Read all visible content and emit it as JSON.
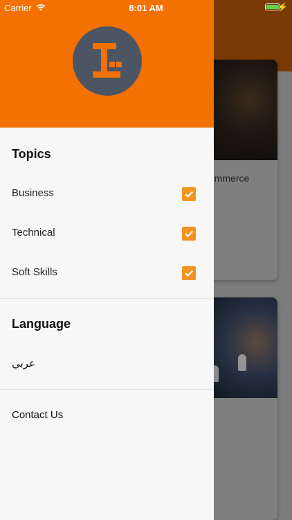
{
  "status_bar": {
    "carrier": "Carrier",
    "time": "8:01 AM",
    "battery_level": 1.0,
    "icons": [
      "wifi-icon",
      "battery-icon",
      "charging-bolt-icon"
    ]
  },
  "background": {
    "card1_partial_title": "ommerce"
  },
  "drawer": {
    "logo_icon": "app-logo-icon",
    "topics_title": "Topics",
    "topics": [
      {
        "label": "Business",
        "checked": true
      },
      {
        "label": "Technical",
        "checked": true
      },
      {
        "label": "Soft Skills",
        "checked": true
      }
    ],
    "language_title": "Language",
    "language_option": "عربي",
    "contact_label": "Contact Us"
  },
  "colors": {
    "accent": "#f27100",
    "checkbox": "#f29424",
    "logo_bg": "#4c5563"
  }
}
